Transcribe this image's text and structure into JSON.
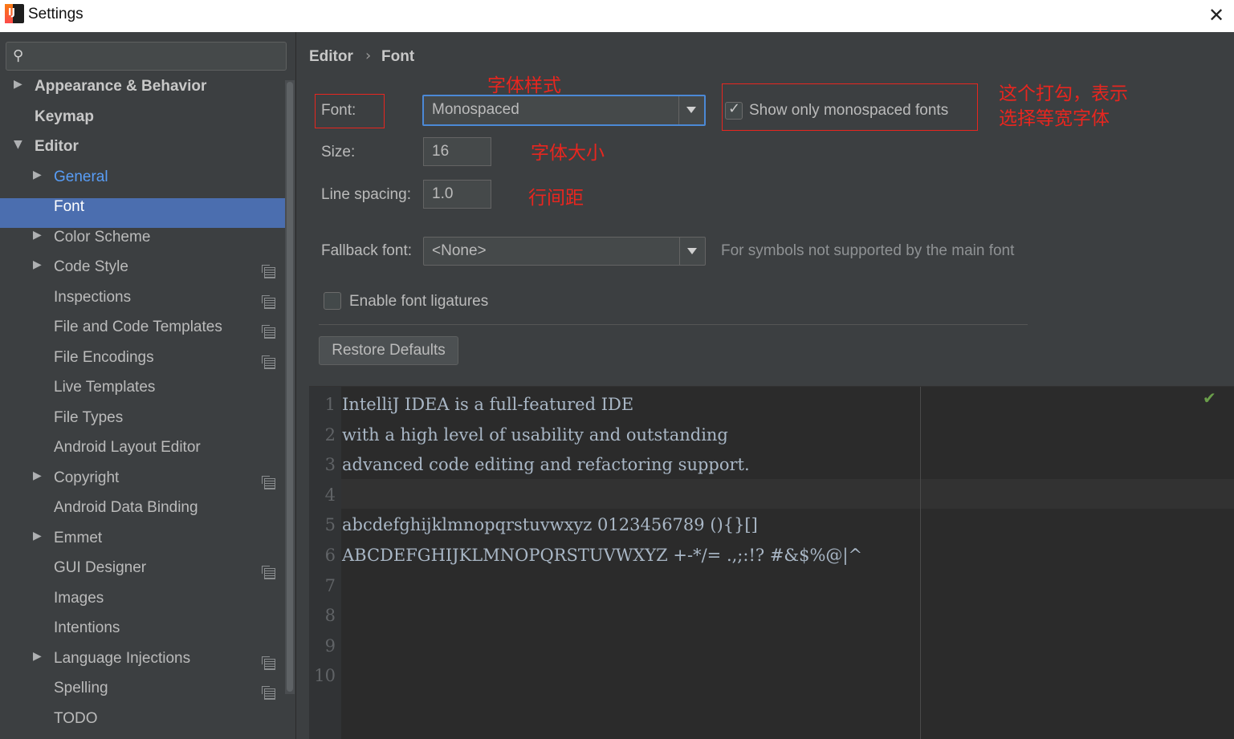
{
  "window": {
    "title": "Settings",
    "close_label": "✕"
  },
  "search": {
    "placeholder": "",
    "icon": "search-icon"
  },
  "sidebar": {
    "items": [
      {
        "label": "Appearance & Behavior",
        "level": 0,
        "expander": "▶"
      },
      {
        "label": "Keymap",
        "level": 0,
        "expander": ""
      },
      {
        "label": "Editor",
        "level": 0,
        "expander": "▼"
      },
      {
        "label": "General",
        "level": 1,
        "expander": "▶"
      },
      {
        "label": "Font",
        "level": 1,
        "expander": "",
        "selected": true
      },
      {
        "label": "Color Scheme",
        "level": 1,
        "expander": "▶"
      },
      {
        "label": "Code Style",
        "level": 1,
        "expander": "▶",
        "project_icon": true
      },
      {
        "label": "Inspections",
        "level": 1,
        "expander": "",
        "project_icon": true
      },
      {
        "label": "File and Code Templates",
        "level": 1,
        "expander": "",
        "project_icon": true
      },
      {
        "label": "File Encodings",
        "level": 1,
        "expander": "",
        "project_icon": true
      },
      {
        "label": "Live Templates",
        "level": 1,
        "expander": ""
      },
      {
        "label": "File Types",
        "level": 1,
        "expander": ""
      },
      {
        "label": "Android Layout Editor",
        "level": 1,
        "expander": ""
      },
      {
        "label": "Copyright",
        "level": 1,
        "expander": "▶",
        "project_icon": true
      },
      {
        "label": "Android Data Binding",
        "level": 1,
        "expander": ""
      },
      {
        "label": "Emmet",
        "level": 1,
        "expander": "▶"
      },
      {
        "label": "GUI Designer",
        "level": 1,
        "expander": "",
        "project_icon": true
      },
      {
        "label": "Images",
        "level": 1,
        "expander": ""
      },
      {
        "label": "Intentions",
        "level": 1,
        "expander": ""
      },
      {
        "label": "Language Injections",
        "level": 1,
        "expander": "▶",
        "project_icon": true
      },
      {
        "label": "Spelling",
        "level": 1,
        "expander": "",
        "project_icon": true
      },
      {
        "label": "TODO",
        "level": 1,
        "expander": ""
      }
    ]
  },
  "breadcrumb": {
    "parent": "Editor",
    "separator": "›",
    "current": "Font"
  },
  "form": {
    "font_label": "Font:",
    "font_value": "Monospaced",
    "show_mono_label": "Show only monospaced fonts",
    "show_mono_checked": true,
    "size_label": "Size:",
    "size_value": "16",
    "line_spacing_label": "Line spacing:",
    "line_spacing_value": "1.0",
    "fallback_label": "Fallback font:",
    "fallback_value": "<None>",
    "fallback_hint": "For symbols not supported by the main font",
    "ligatures_label": "Enable font ligatures",
    "ligatures_checked": false,
    "restore_button": "Restore Defaults"
  },
  "annotations": {
    "font_style": "字体样式",
    "checkbox_note_1": "这个打勾，表示",
    "checkbox_note_2": "选择等宽字体",
    "font_size": "字体大小",
    "line_spacing": "行间距"
  },
  "preview": {
    "lines": [
      {
        "n": "1",
        "text": "IntelliJ IDEA is a full-featured IDE"
      },
      {
        "n": "2",
        "text": "with a high level of usability and outstanding"
      },
      {
        "n": "3",
        "text": "advanced code editing and refactoring support."
      },
      {
        "n": "4",
        "text": ""
      },
      {
        "n": "5",
        "text": "abcdefghijklmnopqrstuvwxyz 0123456789 (){}[]"
      },
      {
        "n": "6",
        "text": "ABCDEFGHIJKLMNOPQRSTUVWXYZ +-*/= .,;:!? #&$%@|^"
      },
      {
        "n": "7",
        "text": ""
      },
      {
        "n": "8",
        "text": ""
      },
      {
        "n": "9",
        "text": ""
      },
      {
        "n": "10",
        "text": ""
      }
    ],
    "status_mark": "✔"
  },
  "colors": {
    "accent": "#4b6eaf",
    "annotation": "#e8261f",
    "link": "#589df6"
  }
}
